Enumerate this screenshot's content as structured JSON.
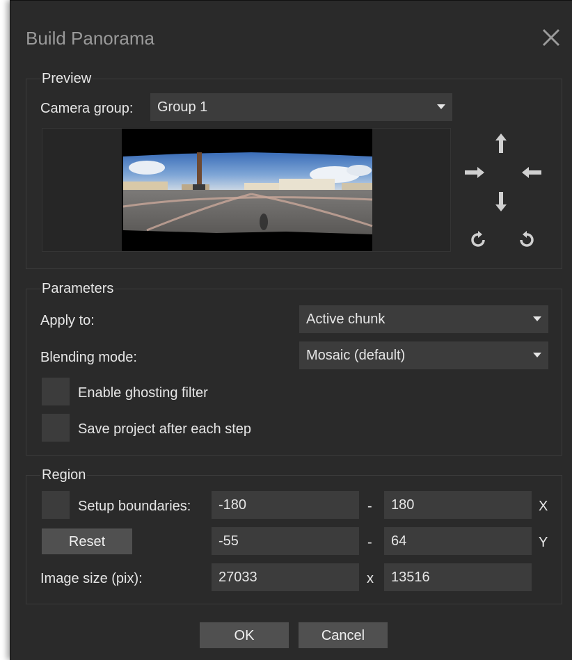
{
  "dialog": {
    "title": "Build Panorama",
    "close_icon": "close-x-icon"
  },
  "preview": {
    "group_label": "Preview",
    "camera_group_label": "Camera group:",
    "camera_group_value": "Group 1",
    "controls": {
      "up": "arrow-up-icon",
      "left": "arrow-right-icon",
      "right": "arrow-left-icon",
      "down": "arrow-down-icon",
      "rotate_ccw": "rotate-left-icon",
      "rotate_cw": "rotate-right-icon"
    }
  },
  "parameters": {
    "group_label": "Parameters",
    "apply_to_label": "Apply to:",
    "apply_to_value": "Active chunk",
    "blending_label": "Blending mode:",
    "blending_value": "Mosaic (default)",
    "ghosting_label": "Enable ghosting filter",
    "ghosting_checked": false,
    "save_label": "Save project after each step",
    "save_checked": false
  },
  "region": {
    "group_label": "Region",
    "setup_boundaries_label": "Setup boundaries:",
    "setup_boundaries_checked": false,
    "reset_label": "Reset",
    "x_min": "-180",
    "x_max": "180",
    "x_axis": "X",
    "y_min": "-55",
    "y_max": "64",
    "y_axis": "Y",
    "range_sep": "-",
    "image_size_label": "Image size (pix):",
    "width": "27033",
    "size_sep": "x",
    "height": "13516"
  },
  "footer": {
    "ok_label": "OK",
    "cancel_label": "Cancel"
  },
  "colors": {
    "background": "#2a2a2a",
    "control": "#3c3c3c",
    "button": "#505050",
    "text": "#e6e6e6",
    "title": "#9a9a9a"
  }
}
